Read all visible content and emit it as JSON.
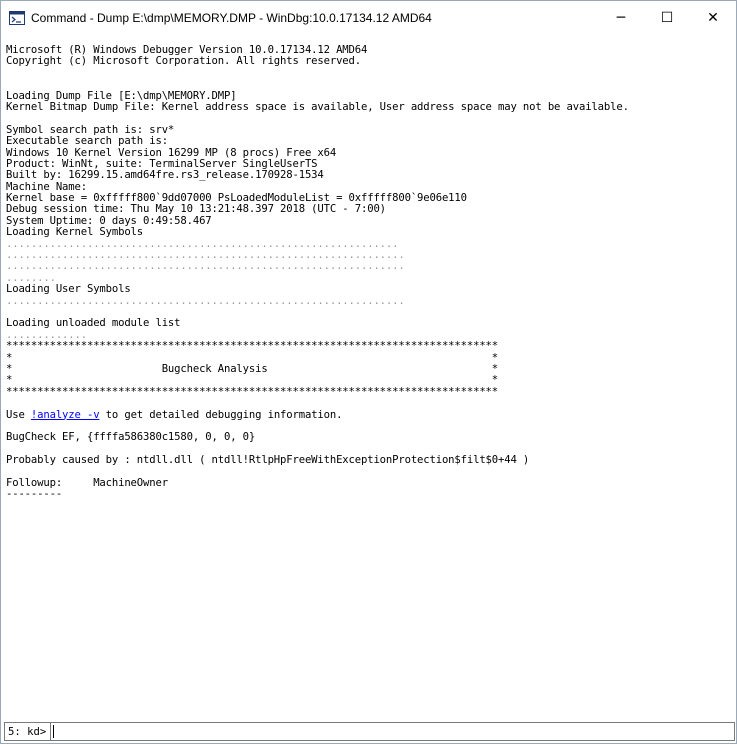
{
  "window": {
    "title": "Command - Dump E:\\dmp\\MEMORY.DMP - WinDbg:10.0.17134.12 AMD64",
    "icon": "command-window-icon",
    "minimize": "─",
    "maximize": "☐",
    "close": "✕"
  },
  "output": {
    "banner": [
      "Microsoft (R) Windows Debugger Version 10.0.17134.12 AMD64",
      "Copyright (c) Microsoft Corporation. All rights reserved."
    ],
    "loading": [
      "Loading Dump File [E:\\dmp\\MEMORY.DMP]",
      "Kernel Bitmap Dump File: Kernel address space is available, User address space may not be available."
    ],
    "info": [
      "Symbol search path is: srv*",
      "Executable search path is:",
      "Windows 10 Kernel Version 16299 MP (8 procs) Free x64",
      "Product: WinNt, suite: TerminalServer SingleUserTS",
      "Built by: 16299.15.amd64fre.rs3_release.170928-1534",
      "Machine Name:",
      "Kernel base = 0xfffff800`9dd07000 PsLoadedModuleList = 0xfffff800`9e06e110",
      "Debug session time: Thu May 10 13:21:48.397 2018 (UTC - 7:00)",
      "System Uptime: 0 days 0:49:58.467",
      "Loading Kernel Symbols"
    ],
    "kernel_dots": [
      "...............................................................",
      "................................................................",
      "................................................................",
      "........"
    ],
    "user_symbols": "Loading User Symbols",
    "user_dots": "................................................................",
    "unloaded": "Loading unloaded module list",
    "unloaded_dots": ".............",
    "bugcheck_box": [
      "*******************************************************************************",
      "*                                                                             *",
      "*                        Bugcheck Analysis                                    *",
      "*                                                                             *",
      "*******************************************************************************"
    ],
    "use_prefix": "Use ",
    "analyze_link": "!analyze -v",
    "use_suffix": " to get detailed debugging information.",
    "bugcheck": "BugCheck EF, {ffffa586380c1580, 0, 0, 0}",
    "probably": "Probably caused by : ntdll.dll ( ntdll!RtlpHpFreeWithExceptionProtection$filt$0+44 )",
    "followup": "Followup:     MachineOwner",
    "separator": "---------"
  },
  "command": {
    "prompt": "5: kd>",
    "value": ""
  }
}
